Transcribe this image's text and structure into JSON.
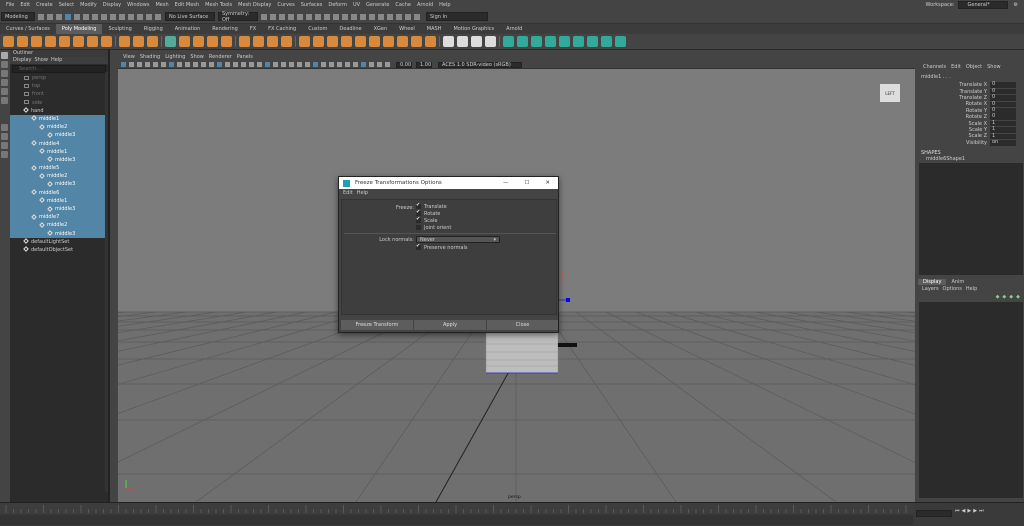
{
  "menu": [
    "File",
    "Edit",
    "Create",
    "Select",
    "Modify",
    "Display",
    "Windows",
    "Mesh",
    "Edit Mesh",
    "Mesh Tools",
    "Mesh Display",
    "Curves",
    "Surfaces",
    "Deform",
    "UV",
    "Generate",
    "Cache",
    "Arnold",
    "Help"
  ],
  "workspace": {
    "label": "Workspace:",
    "value": "General*"
  },
  "status": {
    "mode": "Modeling",
    "surface": "No Live Surface",
    "symmetry": "Symmetry: Off",
    "signin": "Sign In"
  },
  "shelf_tabs": [
    "Curves / Surfaces",
    "Poly Modeling",
    "Sculpting",
    "Rigging",
    "Animation",
    "Rendering",
    "FX",
    "FX Caching",
    "Custom",
    "Deadline",
    "XGen",
    "Wheel",
    "MASH",
    "Motion Graphics",
    "Arnold"
  ],
  "shelf_active": "Poly Modeling",
  "outliner": {
    "title": "Outliner",
    "menu": [
      "Display",
      "Show",
      "Help"
    ],
    "search_placeholder": "Search...",
    "items": [
      {
        "label": "persp",
        "indent": 0,
        "sel": false,
        "dim": true
      },
      {
        "label": "top",
        "indent": 0,
        "sel": false,
        "dim": true
      },
      {
        "label": "front",
        "indent": 0,
        "sel": false,
        "dim": true
      },
      {
        "label": "side",
        "indent": 0,
        "sel": false,
        "dim": true
      },
      {
        "label": "hand",
        "indent": 0,
        "sel": false,
        "dim": false
      },
      {
        "label": "middle1",
        "indent": 1,
        "sel": true,
        "dim": false
      },
      {
        "label": "middle2",
        "indent": 2,
        "sel": true,
        "dim": false
      },
      {
        "label": "middle3",
        "indent": 3,
        "sel": true,
        "dim": false
      },
      {
        "label": "middle4",
        "indent": 1,
        "sel": true,
        "dim": false
      },
      {
        "label": "middle1",
        "indent": 2,
        "sel": true,
        "dim": false
      },
      {
        "label": "middle3",
        "indent": 3,
        "sel": true,
        "dim": false
      },
      {
        "label": "middle5",
        "indent": 1,
        "sel": true,
        "dim": false
      },
      {
        "label": "middle2",
        "indent": 2,
        "sel": true,
        "dim": false
      },
      {
        "label": "middle3",
        "indent": 3,
        "sel": true,
        "dim": false
      },
      {
        "label": "middle6",
        "indent": 1,
        "sel": true,
        "dim": false
      },
      {
        "label": "middle1",
        "indent": 2,
        "sel": true,
        "dim": false
      },
      {
        "label": "middle3",
        "indent": 3,
        "sel": true,
        "dim": false
      },
      {
        "label": "middle7",
        "indent": 1,
        "sel": true,
        "dim": false
      },
      {
        "label": "middle2",
        "indent": 2,
        "sel": true,
        "dim": false
      },
      {
        "label": "middle3",
        "indent": 3,
        "sel": true,
        "dim": false
      },
      {
        "label": "defaultLightSet",
        "indent": 0,
        "sel": false,
        "dim": false
      },
      {
        "label": "defaultObjectSet",
        "indent": 0,
        "sel": false,
        "dim": false
      }
    ]
  },
  "viewport": {
    "menu": [
      "View",
      "Shading",
      "Lighting",
      "Show",
      "Renderer",
      "Panels"
    ],
    "field1": "0.00",
    "field2": "1.00",
    "colorspace": "ACES 1.0 SDR-video (sRGB)",
    "viewcube": "LEFT",
    "camera": "persp"
  },
  "channel_box": {
    "menu": [
      "Channels",
      "Edit",
      "Object",
      "Show"
    ],
    "object": "middle1 . . .",
    "attrs": [
      {
        "name": "Translate X",
        "value": "0"
      },
      {
        "name": "Translate Y",
        "value": "0"
      },
      {
        "name": "Translate Z",
        "value": "0"
      },
      {
        "name": "Rotate X",
        "value": "0"
      },
      {
        "name": "Rotate Y",
        "value": "0"
      },
      {
        "name": "Rotate Z",
        "value": "0"
      },
      {
        "name": "Scale X",
        "value": "1"
      },
      {
        "name": "Scale Y",
        "value": "1"
      },
      {
        "name": "Scale Z",
        "value": "1"
      },
      {
        "name": "Visibility",
        "value": "on"
      }
    ],
    "shapes_title": "SHAPES",
    "shape": "middle6Shape1",
    "layer_tabs": [
      "Display",
      "Anim"
    ],
    "layer_menu": [
      "Layers",
      "Options",
      "Help"
    ]
  },
  "dialog": {
    "title": "Freeze Transformations Options",
    "menu": [
      "Edit",
      "Help"
    ],
    "freeze_label": "Freeze:",
    "options": [
      {
        "label": "Translate",
        "checked": true
      },
      {
        "label": "Rotate",
        "checked": true
      },
      {
        "label": "Scale",
        "checked": true
      },
      {
        "label": "Joint orient",
        "checked": false
      }
    ],
    "lock_label": "Lock normals:",
    "lock_value": "Never",
    "preserve": {
      "label": "Preserve normals",
      "checked": true
    },
    "buttons": [
      "Freeze Transform",
      "Apply",
      "Close"
    ]
  },
  "colors": {
    "selection": "#5285a6",
    "bg": "#444444",
    "panel": "#2b2b2b",
    "viewport": "#7a7a7a"
  }
}
